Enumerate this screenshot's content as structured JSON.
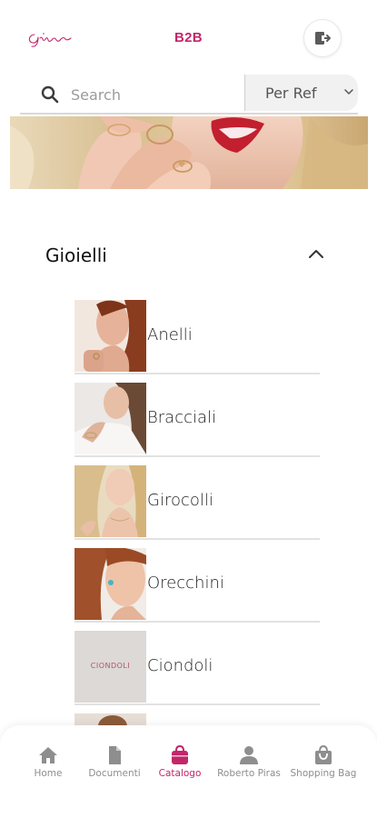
{
  "header": {
    "logo_text": "Giorgio",
    "title": "B2B",
    "logout_icon": "logout-icon"
  },
  "search": {
    "placeholder": "Search",
    "value": "",
    "filter_selected": "Per Ref"
  },
  "section": {
    "title": "Gioielli",
    "expanded": true
  },
  "categories": [
    {
      "label": "Anelli"
    },
    {
      "label": "Bracciali"
    },
    {
      "label": "Girocolli"
    },
    {
      "label": "Orecchini"
    },
    {
      "label": "Ciondoli",
      "thumb_text": "CIONDOLI"
    }
  ],
  "tabbar": {
    "items": [
      {
        "label": "Home",
        "icon": "home-icon",
        "active": false
      },
      {
        "label": "Documenti",
        "icon": "document-icon",
        "active": false
      },
      {
        "label": "Catalogo",
        "icon": "bag-icon",
        "active": true
      },
      {
        "label": "Roberto Piras",
        "icon": "user-icon",
        "active": false
      },
      {
        "label": "Shopping Bag",
        "icon": "shopping-bag-icon",
        "active": false
      }
    ]
  },
  "colors": {
    "accent": "#c2266a",
    "inactive": "#8e8e8e"
  }
}
